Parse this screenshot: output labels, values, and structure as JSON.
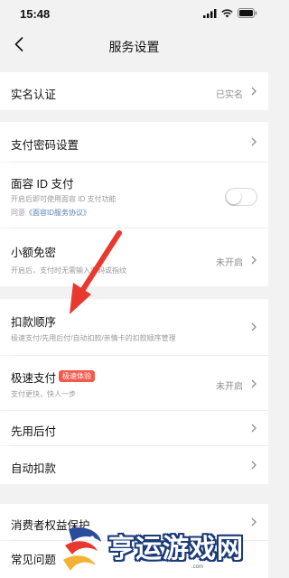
{
  "status_bar": {
    "time": "15:48"
  },
  "nav": {
    "title": "服务设置"
  },
  "rows": {
    "real_name": {
      "title": "实名认证",
      "value": "已实名"
    },
    "payment_password": {
      "title": "支付密码设置"
    },
    "face_id": {
      "title": "面容 ID 支付",
      "sub1": "开启后即可使用面容 ID 支付功能",
      "sub2_prefix": "同意",
      "sub2_link": "《面容ID服务协议》",
      "enabled": false
    },
    "small_free": {
      "title": "小额免密",
      "sub": "开启后，支付时无需输入密码或指纹",
      "value": "未开启"
    },
    "deduction_order": {
      "title": "扣款顺序",
      "sub": "极速支付/先用后付/自动扣款/亲情卡的扣款顺序管理"
    },
    "express_pay": {
      "title": "极速支付",
      "badge": "极速体验",
      "sub": "支付更快，快人一步",
      "value": "未开启"
    },
    "pay_later": {
      "title": "先用后付"
    },
    "auto_deduct": {
      "title": "自动扣款"
    },
    "consumer_rights": {
      "title": "消费者权益保护"
    },
    "faq": {
      "title": "常见问题"
    }
  },
  "watermark": {
    "text": "亨运游戏网",
    "url": ".com"
  },
  "colors": {
    "background": "#f2f2f2",
    "card": "#ffffff",
    "arrow": "#e8392e",
    "badge": "#f25a4e",
    "link": "#5a7fb5"
  },
  "icons": [
    "signal-icon",
    "wifi-icon",
    "battery-icon",
    "back-icon",
    "chevron-right-icon",
    "red-arrow-annotation",
    "watermark-logo"
  ]
}
